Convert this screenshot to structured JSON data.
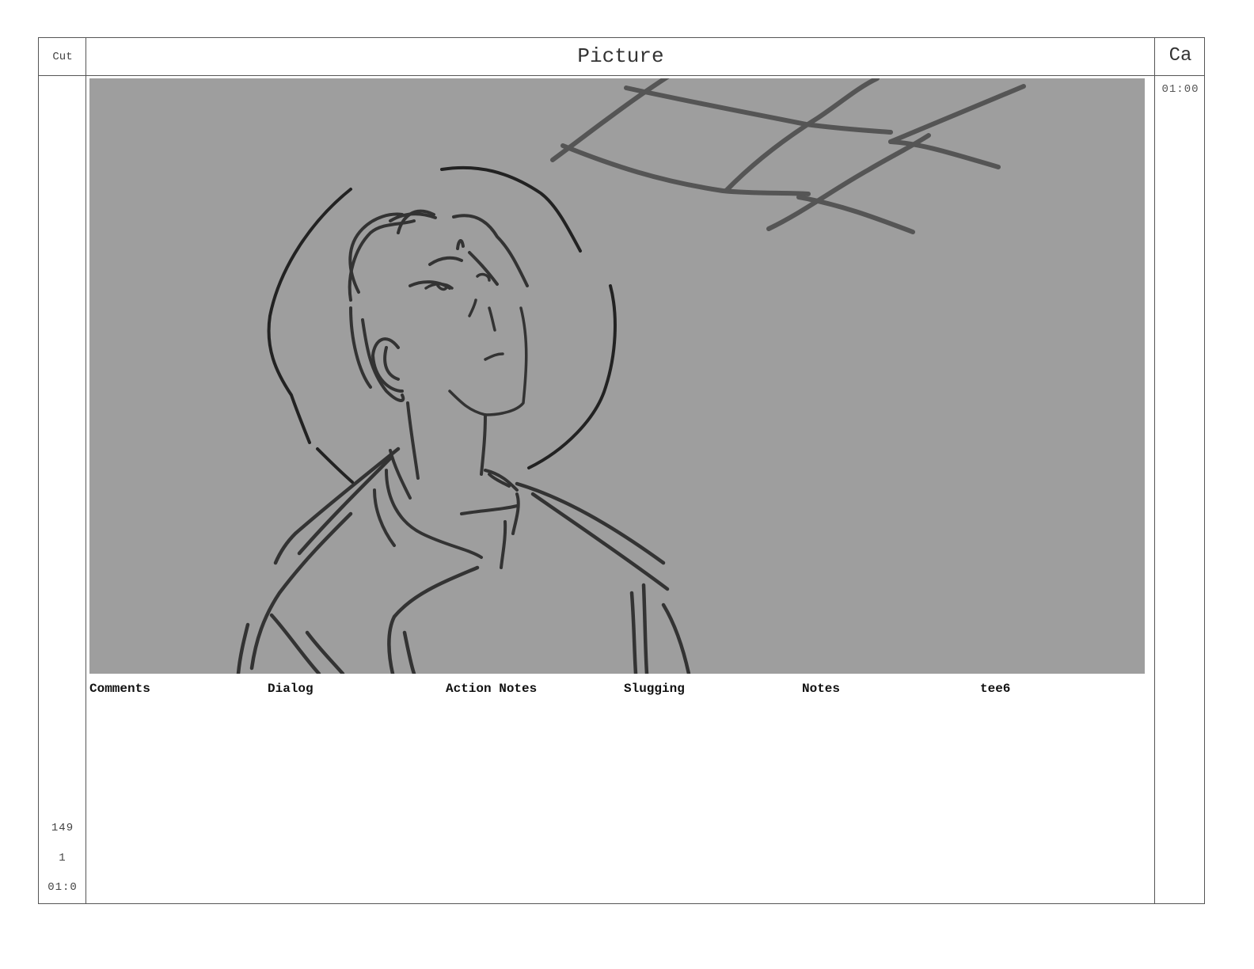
{
  "header": {
    "cut_label": "Cut",
    "picture_label": "Picture",
    "camera_label": "Ca"
  },
  "camera_column": {
    "time": "01:00"
  },
  "cut_column": {
    "scene_number": "149",
    "panel_number": "1",
    "duration": "01:0"
  },
  "notes": {
    "labels": [
      "Comments",
      "Dialog",
      "Action Notes",
      "Slugging",
      "Notes",
      "tee6"
    ]
  },
  "panel": {
    "background_color": "#9e9e9e",
    "line_color": "#2e2e2e",
    "icon": "storyboard-sketch-figure-looking-up"
  }
}
